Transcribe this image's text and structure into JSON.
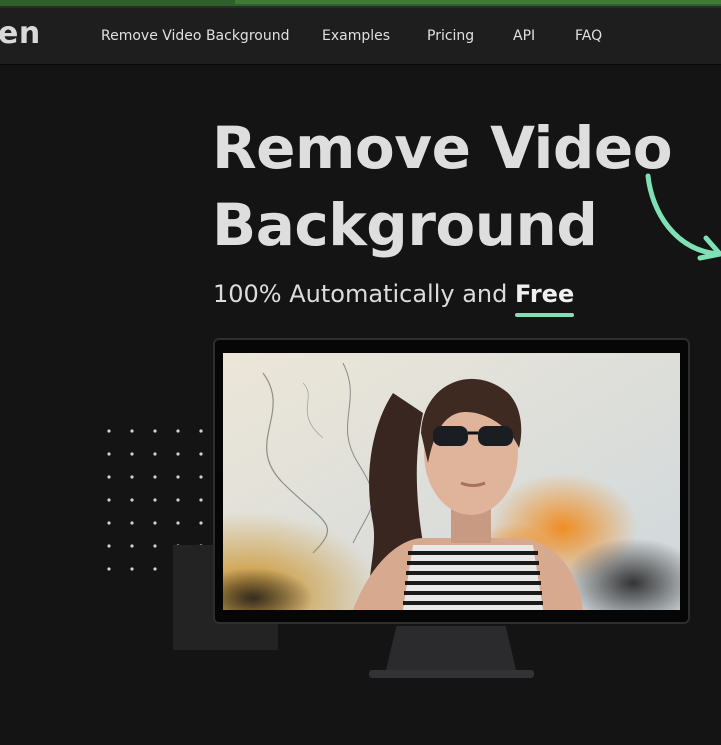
{
  "brand": {
    "logo_text": "en"
  },
  "nav": {
    "items": [
      {
        "label": "Remove Video Background"
      },
      {
        "label": "Examples"
      },
      {
        "label": "Pricing"
      },
      {
        "label": "API"
      },
      {
        "label": "FAQ"
      }
    ]
  },
  "hero": {
    "title_line1": "Remove Video",
    "title_line2": "Background",
    "subtitle_prefix": "100% Automatically and ",
    "subtitle_emphasis": "Free"
  },
  "colors": {
    "accent": "#7fe0b6",
    "background": "#141414",
    "navbar": "#1e1e1e"
  }
}
